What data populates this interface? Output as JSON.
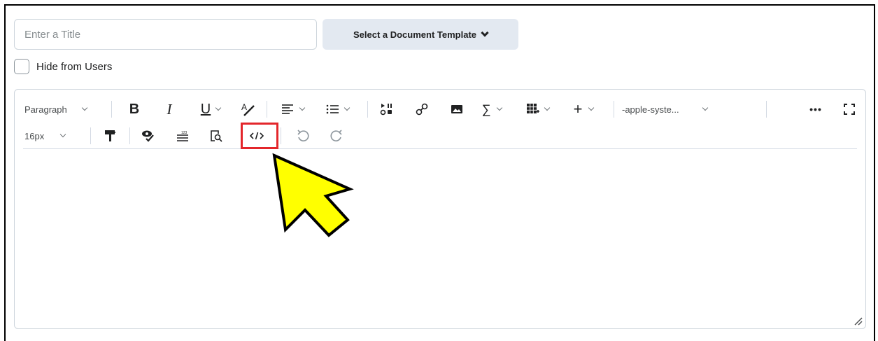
{
  "title_field": {
    "placeholder": "Enter a Title"
  },
  "template_button": {
    "label": "Select a Document Template"
  },
  "hide_from_users": {
    "label": "Hide from Users",
    "checked": false
  },
  "toolbar": {
    "block_format": "Paragraph",
    "font_family": "-apple-syste...",
    "font_size": "16px",
    "more": "•••"
  },
  "colors": {
    "highlight": "#e3262b",
    "arrow_fill": "#ffff00",
    "button_bg": "#e3e9f1"
  }
}
